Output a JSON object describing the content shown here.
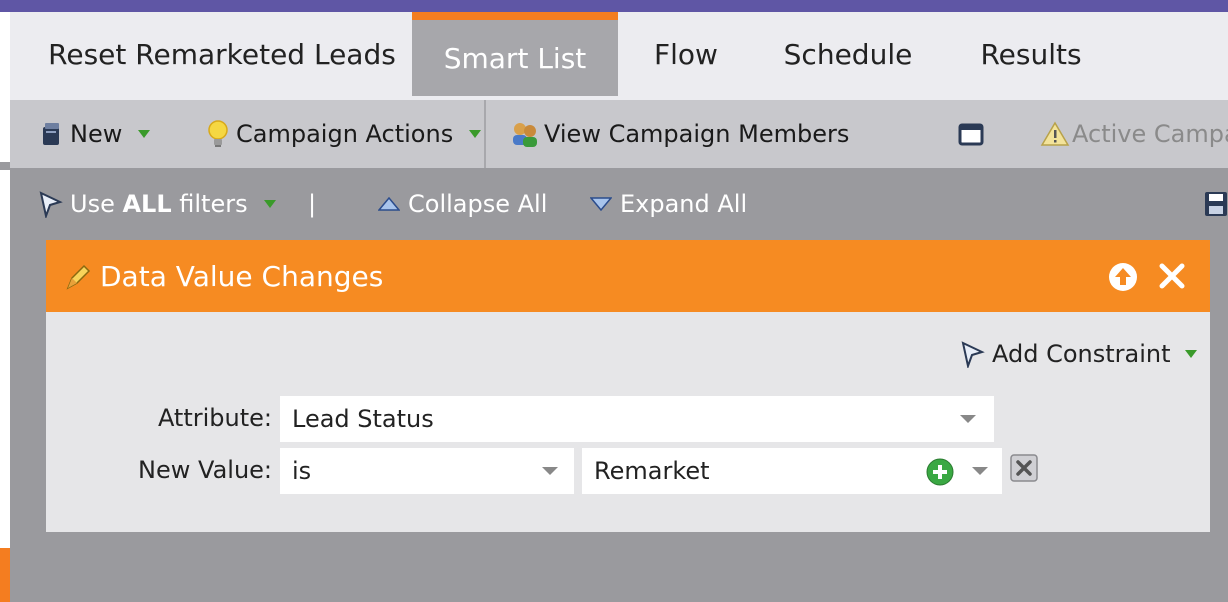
{
  "tabs": [
    {
      "label": "Reset Remarketed Leads",
      "active": false
    },
    {
      "label": "Smart List",
      "active": true
    },
    {
      "label": "Flow",
      "active": false
    },
    {
      "label": "Schedule",
      "active": false
    },
    {
      "label": "Results",
      "active": false
    }
  ],
  "toolbar": {
    "new_label": "New",
    "campaign_actions_label": "Campaign Actions",
    "view_members_label": "View Campaign Members",
    "active_campaign_label": "Active Campai"
  },
  "filterbar": {
    "use_prefix": "Use ",
    "use_bold": "ALL",
    "use_suffix": " filters",
    "divider": "|",
    "collapse_label": "Collapse All",
    "expand_label": "Expand All"
  },
  "filter": {
    "title": "Data Value Changes",
    "add_constraint_label": "Add Constraint",
    "attribute_label": "Attribute:",
    "attribute_value": "Lead Status",
    "new_value_label": "New Value:",
    "operator_value": "is",
    "value_value": "Remarket"
  },
  "colors": {
    "accent_orange": "#f68b22",
    "tab_top_border": "#f47d20",
    "top_bar_purple": "#5f56a5",
    "add_green": "#3aa843"
  }
}
